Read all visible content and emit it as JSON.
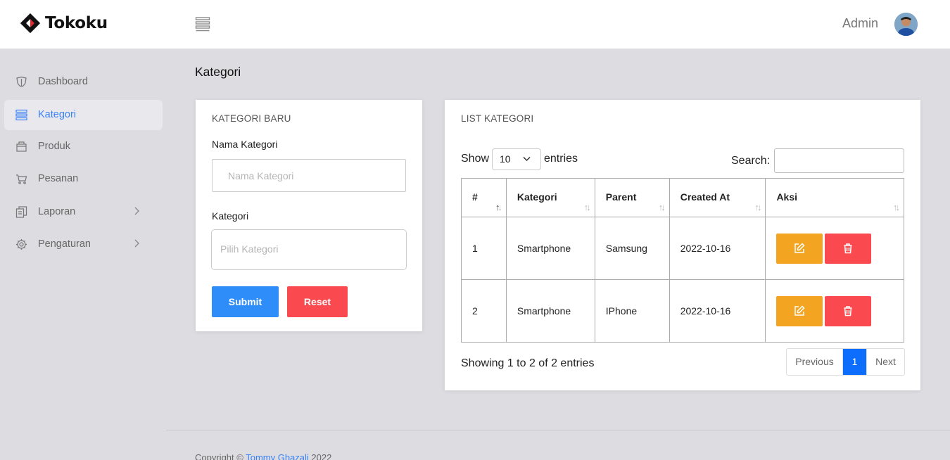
{
  "brand": {
    "name": "Tokoku"
  },
  "header": {
    "user_name": "Admin"
  },
  "sidebar": {
    "items": [
      {
        "label": "Dashboard",
        "icon": "shield-icon"
      },
      {
        "label": "Kategori",
        "icon": "list-icon",
        "active": true
      },
      {
        "label": "Produk",
        "icon": "package-icon"
      },
      {
        "label": "Pesanan",
        "icon": "cart-icon"
      },
      {
        "label": "Laporan",
        "icon": "documents-icon",
        "has_submenu": true
      },
      {
        "label": "Pengaturan",
        "icon": "gear-icon",
        "has_submenu": true
      }
    ]
  },
  "page": {
    "title": "Kategori"
  },
  "form": {
    "title": "KATEGORI BARU",
    "name_label": "Nama Kategori",
    "name_placeholder": "Nama Kategori",
    "category_label": "Kategori",
    "category_placeholder": "Pilih Kategori",
    "submit_label": "Submit",
    "reset_label": "Reset"
  },
  "list": {
    "title": "LIST KATEGORI",
    "show_label": "Show",
    "length_value": "10",
    "entries_label": "entries",
    "search_label": "Search:",
    "columns": [
      "#",
      "Kategori",
      "Parent",
      "Created At",
      "Aksi"
    ],
    "rows": [
      {
        "no": "1",
        "kategori": "Smartphone",
        "parent": "Samsung",
        "created_at": "2022-10-16"
      },
      {
        "no": "2",
        "kategori": "Smartphone",
        "parent": "IPhone",
        "created_at": "2022-10-16"
      }
    ],
    "info": "Showing 1 to 2 of 2 entries",
    "pagination": {
      "previous": "Previous",
      "current": "1",
      "next": "Next"
    }
  },
  "footer": {
    "prefix": "Copyright ©",
    "author": "Tommy Ghazali",
    "year": "2022"
  },
  "colors": {
    "primary": "#2e8df9",
    "danger": "#fb4a4f",
    "warning": "#f3a521",
    "active_link": "#3b82f6"
  }
}
